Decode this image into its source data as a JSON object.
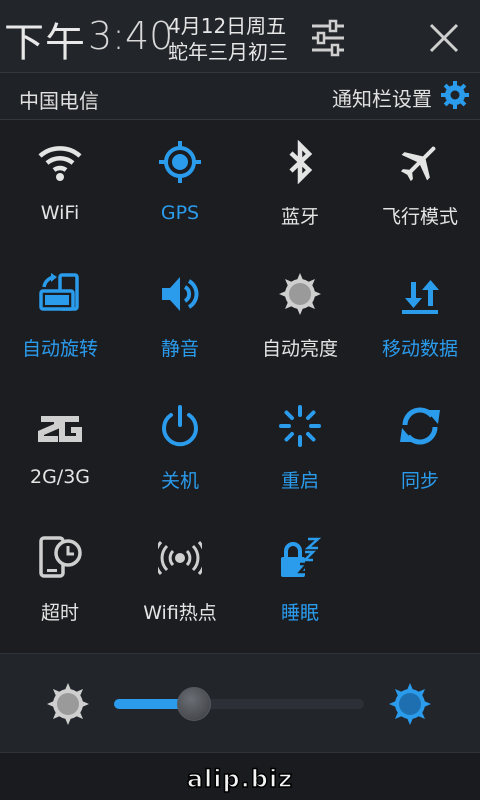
{
  "status": {
    "time_prefix": "下午",
    "time": "3:40",
    "date_line1": "4月12日周五",
    "date_line2": "蛇年三月初三",
    "settings_icon": "sliders-icon",
    "close_icon": "close-icon"
  },
  "carrier": {
    "name": "中国电信",
    "settings_label": "通知栏设置",
    "settings_icon": "gear-icon"
  },
  "colors": {
    "accent": "#2b9bec",
    "text": "#e4e4e4",
    "background": "#1b1d21"
  },
  "toggles": [
    {
      "label": "WiFi",
      "icon": "wifi-icon",
      "active": false
    },
    {
      "label": "GPS",
      "icon": "gps-icon",
      "active": true
    },
    {
      "label": "蓝牙",
      "icon": "bluetooth-icon",
      "active": false
    },
    {
      "label": "飞行模式",
      "icon": "airplane-icon",
      "active": false
    },
    {
      "label": "自动旋转",
      "icon": "rotate-icon",
      "active": true
    },
    {
      "label": "静音",
      "icon": "speaker-icon",
      "active": true
    },
    {
      "label": "自动亮度",
      "icon": "sun-icon",
      "active": false
    },
    {
      "label": "移动数据",
      "icon": "data-arrows-icon",
      "active": true
    },
    {
      "label": "2G/3G",
      "icon": "2g-icon",
      "active": false
    },
    {
      "label": "关机",
      "icon": "power-icon",
      "active": true
    },
    {
      "label": "重启",
      "icon": "restart-spinner-icon",
      "active": true
    },
    {
      "label": "同步",
      "icon": "sync-icon",
      "active": true
    },
    {
      "label": "超时",
      "icon": "timeout-icon",
      "active": false
    },
    {
      "label": "Wifi热点",
      "icon": "hotspot-icon",
      "active": false
    },
    {
      "label": "睡眠",
      "icon": "sleep-lock-icon",
      "active": true
    }
  ],
  "brightness": {
    "level": 0.32,
    "low_icon": "brightness-low-icon",
    "high_icon": "brightness-high-icon"
  },
  "watermark": "alip.biz"
}
